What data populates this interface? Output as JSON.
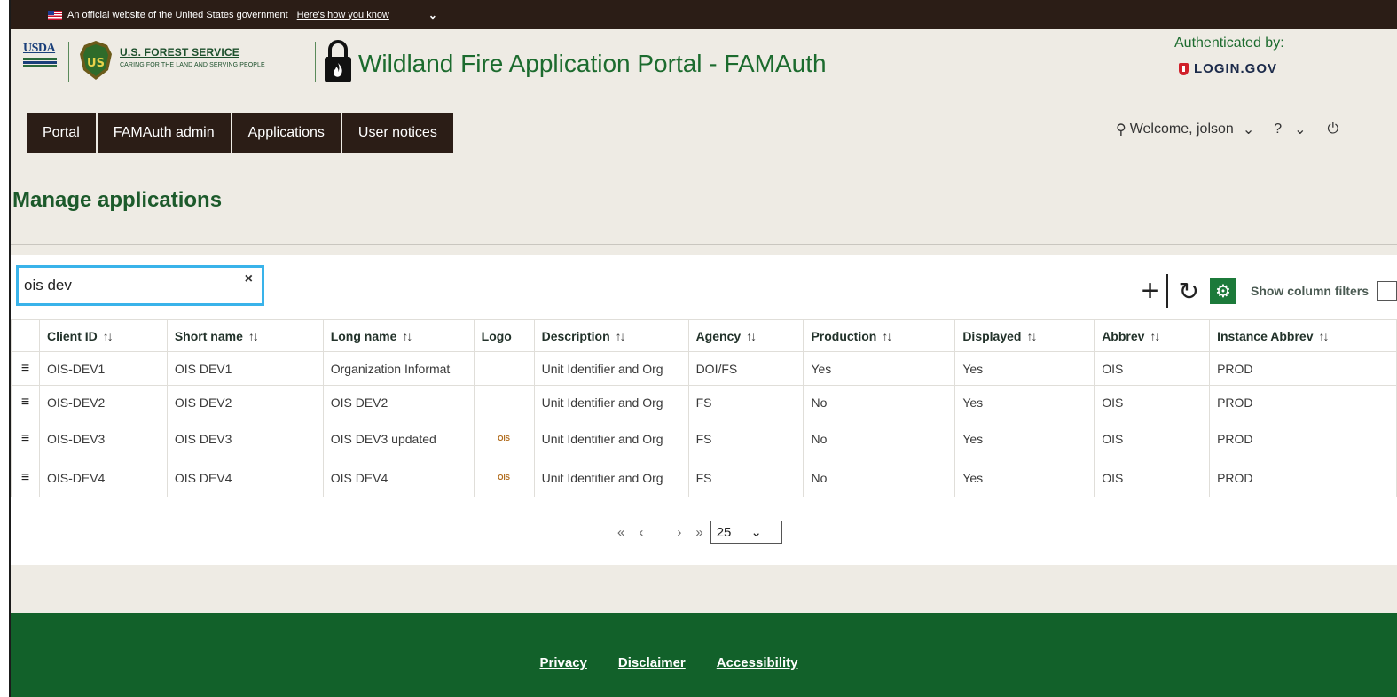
{
  "gov_banner": {
    "text": "An official website of the United States government",
    "link": "Here's how you know"
  },
  "header": {
    "usda": "USDA",
    "agency_name": "U.S. FOREST SERVICE",
    "agency_tagline": "CARING FOR THE LAND AND SERVING PEOPLE",
    "app_title": "Wildland Fire Application Portal - FAMAuth",
    "auth_label": "Authenticated by:",
    "auth_provider": "LOGIN.GOV"
  },
  "nav": {
    "items": [
      "Portal",
      "FAMAuth admin",
      "Applications",
      "User notices"
    ]
  },
  "user": {
    "welcome": "Welcome, jolson"
  },
  "page": {
    "title": "Manage applications"
  },
  "search": {
    "value": "ois dev"
  },
  "toolbar": {
    "column_filters_label": "Show column filters"
  },
  "table": {
    "columns": [
      "Client ID",
      "Short name",
      "Long name",
      "Logo",
      "Description",
      "Agency",
      "Production",
      "Displayed",
      "Abbrev",
      "Instance Abbrev"
    ],
    "rows": [
      {
        "client_id": "OIS-DEV1",
        "short": "OIS DEV1",
        "long": "Organization Informat",
        "logo": "",
        "desc": "Unit Identifier and Org",
        "agency": "DOI/FS",
        "prod": "Yes",
        "displayed": "Yes",
        "abbrev": "OIS",
        "instance": "PROD"
      },
      {
        "client_id": "OIS-DEV2",
        "short": "OIS DEV2",
        "long": "OIS DEV2",
        "logo": "",
        "desc": "Unit Identifier and Org",
        "agency": "FS",
        "prod": "No",
        "displayed": "Yes",
        "abbrev": "OIS",
        "instance": "PROD"
      },
      {
        "client_id": "OIS-DEV3",
        "short": "OIS DEV3",
        "long": "OIS DEV3 updated",
        "logo": "OIS",
        "desc": "Unit Identifier and Org",
        "agency": "FS",
        "prod": "No",
        "displayed": "Yes",
        "abbrev": "OIS",
        "instance": "PROD"
      },
      {
        "client_id": "OIS-DEV4",
        "short": "OIS DEV4",
        "long": "OIS DEV4",
        "logo": "OIS",
        "desc": "Unit Identifier and Org",
        "agency": "FS",
        "prod": "No",
        "displayed": "Yes",
        "abbrev": "OIS",
        "instance": "PROD"
      }
    ]
  },
  "pager": {
    "page_size": "25"
  },
  "footer": {
    "links": [
      "Privacy",
      "Disclaimer",
      "Accessibility"
    ]
  }
}
